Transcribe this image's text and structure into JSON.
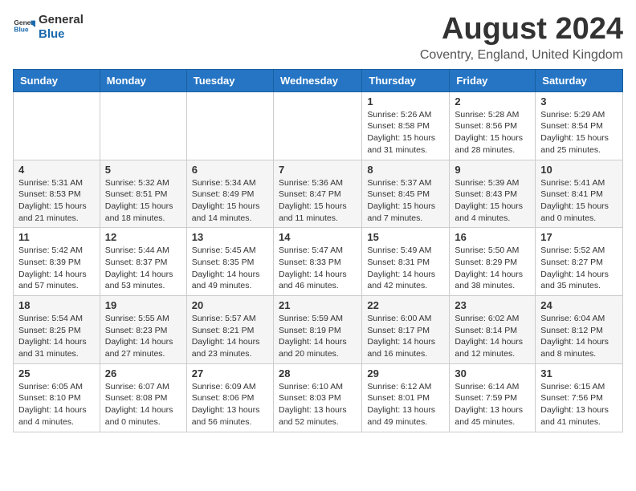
{
  "header": {
    "logo_general": "General",
    "logo_blue": "Blue",
    "month_title": "August 2024",
    "location": "Coventry, England, United Kingdom"
  },
  "days_of_week": [
    "Sunday",
    "Monday",
    "Tuesday",
    "Wednesday",
    "Thursday",
    "Friday",
    "Saturday"
  ],
  "weeks": [
    [
      {
        "day": "",
        "info": ""
      },
      {
        "day": "",
        "info": ""
      },
      {
        "day": "",
        "info": ""
      },
      {
        "day": "",
        "info": ""
      },
      {
        "day": "1",
        "info": "Sunrise: 5:26 AM\nSunset: 8:58 PM\nDaylight: 15 hours\nand 31 minutes."
      },
      {
        "day": "2",
        "info": "Sunrise: 5:28 AM\nSunset: 8:56 PM\nDaylight: 15 hours\nand 28 minutes."
      },
      {
        "day": "3",
        "info": "Sunrise: 5:29 AM\nSunset: 8:54 PM\nDaylight: 15 hours\nand 25 minutes."
      }
    ],
    [
      {
        "day": "4",
        "info": "Sunrise: 5:31 AM\nSunset: 8:53 PM\nDaylight: 15 hours\nand 21 minutes."
      },
      {
        "day": "5",
        "info": "Sunrise: 5:32 AM\nSunset: 8:51 PM\nDaylight: 15 hours\nand 18 minutes."
      },
      {
        "day": "6",
        "info": "Sunrise: 5:34 AM\nSunset: 8:49 PM\nDaylight: 15 hours\nand 14 minutes."
      },
      {
        "day": "7",
        "info": "Sunrise: 5:36 AM\nSunset: 8:47 PM\nDaylight: 15 hours\nand 11 minutes."
      },
      {
        "day": "8",
        "info": "Sunrise: 5:37 AM\nSunset: 8:45 PM\nDaylight: 15 hours\nand 7 minutes."
      },
      {
        "day": "9",
        "info": "Sunrise: 5:39 AM\nSunset: 8:43 PM\nDaylight: 15 hours\nand 4 minutes."
      },
      {
        "day": "10",
        "info": "Sunrise: 5:41 AM\nSunset: 8:41 PM\nDaylight: 15 hours\nand 0 minutes."
      }
    ],
    [
      {
        "day": "11",
        "info": "Sunrise: 5:42 AM\nSunset: 8:39 PM\nDaylight: 14 hours\nand 57 minutes."
      },
      {
        "day": "12",
        "info": "Sunrise: 5:44 AM\nSunset: 8:37 PM\nDaylight: 14 hours\nand 53 minutes."
      },
      {
        "day": "13",
        "info": "Sunrise: 5:45 AM\nSunset: 8:35 PM\nDaylight: 14 hours\nand 49 minutes."
      },
      {
        "day": "14",
        "info": "Sunrise: 5:47 AM\nSunset: 8:33 PM\nDaylight: 14 hours\nand 46 minutes."
      },
      {
        "day": "15",
        "info": "Sunrise: 5:49 AM\nSunset: 8:31 PM\nDaylight: 14 hours\nand 42 minutes."
      },
      {
        "day": "16",
        "info": "Sunrise: 5:50 AM\nSunset: 8:29 PM\nDaylight: 14 hours\nand 38 minutes."
      },
      {
        "day": "17",
        "info": "Sunrise: 5:52 AM\nSunset: 8:27 PM\nDaylight: 14 hours\nand 35 minutes."
      }
    ],
    [
      {
        "day": "18",
        "info": "Sunrise: 5:54 AM\nSunset: 8:25 PM\nDaylight: 14 hours\nand 31 minutes."
      },
      {
        "day": "19",
        "info": "Sunrise: 5:55 AM\nSunset: 8:23 PM\nDaylight: 14 hours\nand 27 minutes."
      },
      {
        "day": "20",
        "info": "Sunrise: 5:57 AM\nSunset: 8:21 PM\nDaylight: 14 hours\nand 23 minutes."
      },
      {
        "day": "21",
        "info": "Sunrise: 5:59 AM\nSunset: 8:19 PM\nDaylight: 14 hours\nand 20 minutes."
      },
      {
        "day": "22",
        "info": "Sunrise: 6:00 AM\nSunset: 8:17 PM\nDaylight: 14 hours\nand 16 minutes."
      },
      {
        "day": "23",
        "info": "Sunrise: 6:02 AM\nSunset: 8:14 PM\nDaylight: 14 hours\nand 12 minutes."
      },
      {
        "day": "24",
        "info": "Sunrise: 6:04 AM\nSunset: 8:12 PM\nDaylight: 14 hours\nand 8 minutes."
      }
    ],
    [
      {
        "day": "25",
        "info": "Sunrise: 6:05 AM\nSunset: 8:10 PM\nDaylight: 14 hours\nand 4 minutes."
      },
      {
        "day": "26",
        "info": "Sunrise: 6:07 AM\nSunset: 8:08 PM\nDaylight: 14 hours\nand 0 minutes."
      },
      {
        "day": "27",
        "info": "Sunrise: 6:09 AM\nSunset: 8:06 PM\nDaylight: 13 hours\nand 56 minutes."
      },
      {
        "day": "28",
        "info": "Sunrise: 6:10 AM\nSunset: 8:03 PM\nDaylight: 13 hours\nand 52 minutes."
      },
      {
        "day": "29",
        "info": "Sunrise: 6:12 AM\nSunset: 8:01 PM\nDaylight: 13 hours\nand 49 minutes."
      },
      {
        "day": "30",
        "info": "Sunrise: 6:14 AM\nSunset: 7:59 PM\nDaylight: 13 hours\nand 45 minutes."
      },
      {
        "day": "31",
        "info": "Sunrise: 6:15 AM\nSunset: 7:56 PM\nDaylight: 13 hours\nand 41 minutes."
      }
    ]
  ]
}
